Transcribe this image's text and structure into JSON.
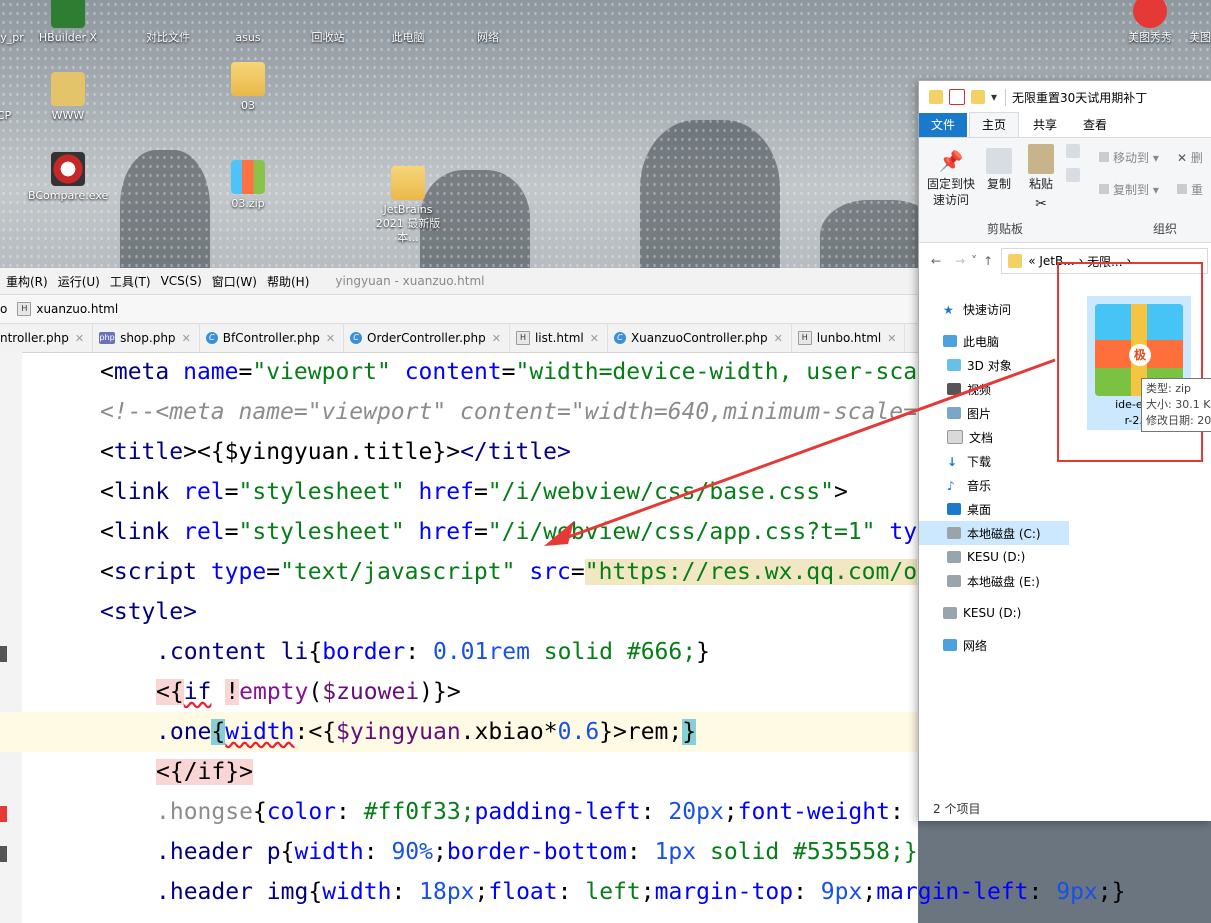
{
  "desktop": {
    "icons": [
      {
        "label": "HBuilder X"
      },
      {
        "label": "对比文件"
      },
      {
        "label": "asus"
      },
      {
        "label": "回收站"
      },
      {
        "label": "此电脑"
      },
      {
        "label": "网络"
      },
      {
        "label": "y_pr"
      },
      {
        "label": "WWW"
      },
      {
        "label": "03"
      },
      {
        "label": "CP"
      },
      {
        "label": "BCompare.exe"
      },
      {
        "label": "03.zip"
      },
      {
        "label": "JetBrains 2021 最新版本..."
      },
      {
        "label": "美图秀秀"
      },
      {
        "label": "美图"
      }
    ]
  },
  "ide": {
    "menu": [
      "重构(R)",
      "运行(U)",
      "工具(T)",
      "VCS(S)",
      "窗口(W)",
      "帮助(H)"
    ],
    "window_title": "yingyuan - xuanzuo.html",
    "breadcrumb": {
      "prefix": "o",
      "file": "xuanzuo.html"
    },
    "tabs": [
      {
        "label": "ntroller.php",
        "icon": "php"
      },
      {
        "label": "shop.php",
        "icon": "php"
      },
      {
        "label": "BfController.php",
        "icon": "class"
      },
      {
        "label": "OrderController.php",
        "icon": "class"
      },
      {
        "label": "list.html",
        "icon": "html"
      },
      {
        "label": "XuanzuoController.php",
        "icon": "class"
      },
      {
        "label": "lunbo.html",
        "icon": "html"
      }
    ],
    "code": {
      "l1": {
        "tag": "meta",
        "a1": "name",
        "v1": "\"viewport\"",
        "a2": "content",
        "v2": "\"width=device-width, user-sca"
      },
      "l2": "<!--<meta name=\"viewport\" content=\"width=640,minimum-scale=",
      "l3": {
        "open": "title",
        "expr": "{$yingyuan.title}",
        "close": "</title>"
      },
      "l4": {
        "tag": "link",
        "a1": "rel",
        "v1": "\"stylesheet\"",
        "a2": "href",
        "v2": "\"/i/webview/css/base.css\"",
        "end": ">"
      },
      "l5": {
        "tag": "link",
        "a1": "rel",
        "v1": "\"stylesheet\"",
        "a2": "href",
        "v2": "\"/i/webview/css/app.css?t=1\"",
        "a3": "ty"
      },
      "l6": {
        "tag": "script",
        "a1": "type",
        "v1": "\"text/javascript\"",
        "a2": "src",
        "url": "\"https://res.wx.qq.com/o"
      },
      "l7": "<style>",
      "l8": {
        "sel": ".content li",
        "prop": "border",
        "num": "0.01rem",
        "rest": "solid #666;"
      },
      "l9": {
        "pre": "<{",
        "kw": "if",
        "neg": "!",
        "fn": "empty",
        "var": "$zuowei",
        "post": ")}>"
      },
      "l10": {
        "sel": ".one",
        "prop": "width",
        "expr1": ":<{",
        "var": "$yingyuan",
        "field": ".xbiao",
        "op": "*",
        "num": "0.6",
        "rest": "}>rem;"
      },
      "l11": "<{/if}>",
      "l12": {
        "sel": ".hongse",
        "p1": "color",
        "v1": "#ff0f33;",
        "p2": "padding-left",
        "n2": "20px",
        "p3": "font-weight",
        "tail": "..."
      },
      "l13": {
        "sel": ".header p",
        "p1": "width",
        "n1": "90%",
        "p2": "border-bottom",
        "n2": "1px",
        "rest": "solid #535558;}"
      },
      "l14": {
        "sel": ".header img",
        "p1": "width",
        "n1": "18px",
        "p2": "float",
        "v2": "left",
        "p3": "margin-top",
        "n3": "9px",
        "p4": "margin-left",
        "n4": "9px"
      }
    }
  },
  "explorer": {
    "title": "无限重置30天试用期补丁",
    "ribbon_tabs": [
      "文件",
      "主页",
      "共享",
      "查看"
    ],
    "buttons": {
      "pin": "固定到快速访问",
      "copy": "复制",
      "paste": "粘贴",
      "moveto": "移动到",
      "delete": "删",
      "copyto": "复制到",
      "rename": "重"
    },
    "groups": {
      "clipboard": "剪贴板",
      "organize": "组织"
    },
    "address": {
      "prefix": "«",
      "part1": "JetB...",
      "part2": "无限..."
    },
    "nav": [
      "快速访问",
      "此电脑",
      "3D 对象",
      "视频",
      "图片",
      "文档",
      "下载",
      "音乐",
      "桌面",
      "本地磁盘 (C:)",
      "KESU (D:)",
      "本地磁盘 (E:)",
      "KESU (D:)",
      "网络"
    ],
    "file": {
      "line1": "ide-eval-",
      "line2": "r-2.1."
    },
    "tooltip": {
      "type": "类型: zip",
      "size": "大小: 30.1 K",
      "modified": "修改日期: 20"
    },
    "status": "2 个项目"
  }
}
